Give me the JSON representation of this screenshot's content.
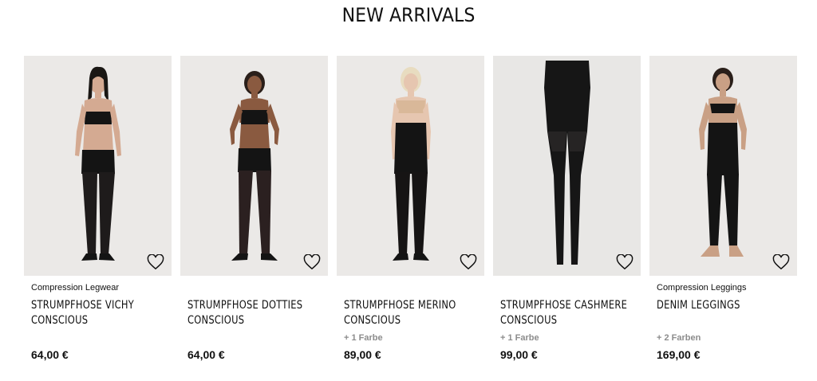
{
  "section": {
    "title": "NEW ARRIVALS"
  },
  "products": [
    {
      "category": "Compression Legwear",
      "name": "STRUMPFHOSE VICHY CONSCIOUS",
      "colors": "",
      "price": "64,00 €",
      "wishlist_icon": "heart-outline-icon"
    },
    {
      "category": "",
      "name": "STRUMPFHOSE DOTTIES CONSCIOUS",
      "colors": "",
      "price": "64,00 €",
      "wishlist_icon": "heart-outline-icon"
    },
    {
      "category": "",
      "name": "STRUMPFHOSE MERINO CONSCIOUS",
      "colors": "+ 1 Farbe",
      "price": "89,00 €",
      "wishlist_icon": "heart-outline-icon"
    },
    {
      "category": "",
      "name": "STRUMPFHOSE CASHMERE CONSCIOUS",
      "colors": "+ 1 Farbe",
      "price": "99,00 €",
      "wishlist_icon": "heart-outline-icon"
    },
    {
      "category": "Compression Leggings",
      "name": "DENIM LEGGINGS",
      "colors": "+ 2 Farben",
      "price": "169,00 €",
      "wishlist_icon": "heart-outline-icon"
    }
  ],
  "colors": {
    "photo_bg": "#ebe9e7",
    "text": "#111111",
    "muted": "#8c8c8c",
    "garment": "#141414",
    "skin": "#d9b39a"
  }
}
